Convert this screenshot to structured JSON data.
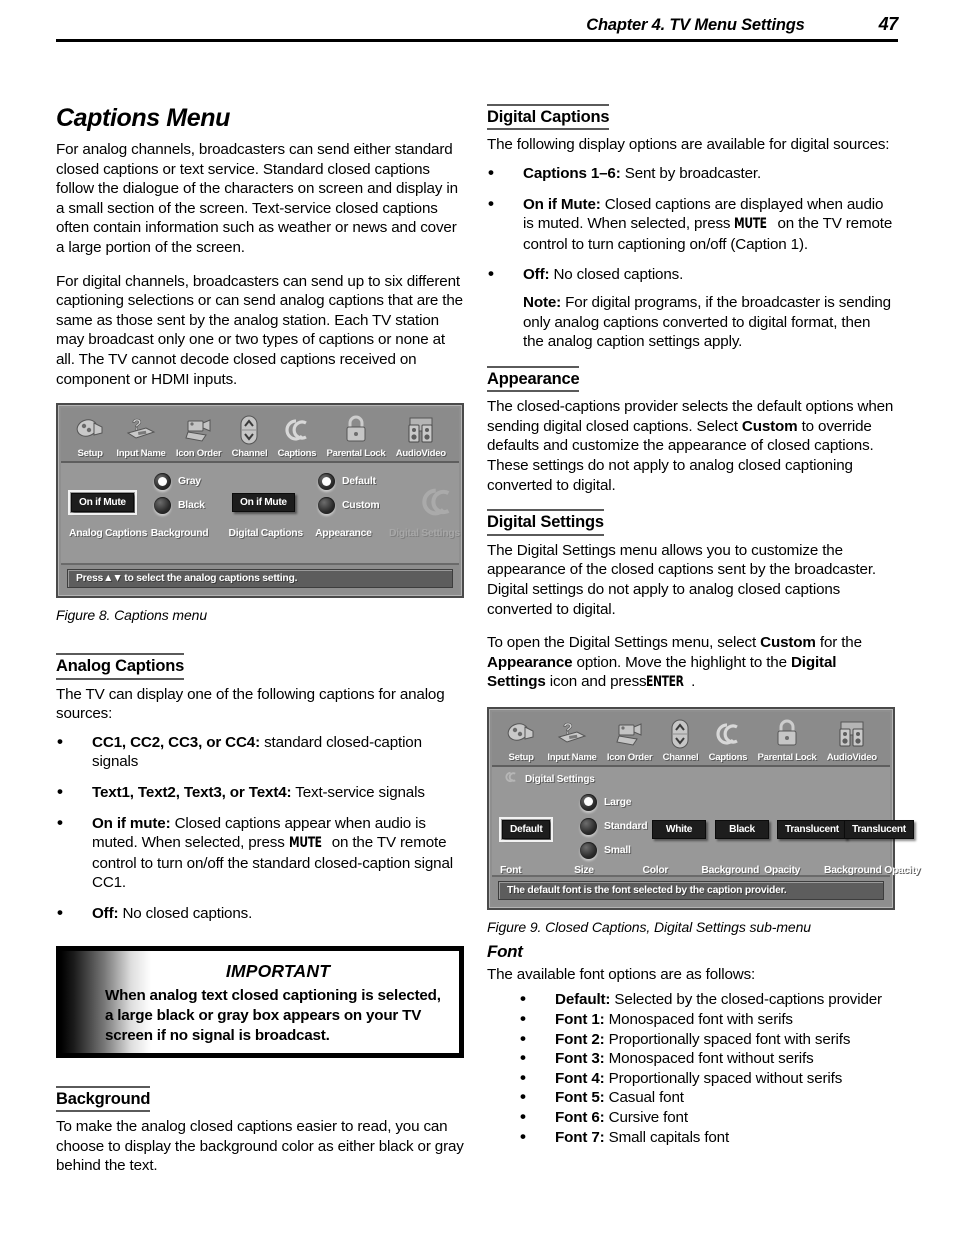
{
  "header": {
    "title": "Chapter 4. TV Menu Settings",
    "page_number": "47"
  },
  "left_column": {
    "doc_title": "Captions Menu",
    "intro_p1": "For analog channels, broadcasters can send either standard closed captions or text service.  Standard closed captions follow the dialogue of the characters on screen and display in a small section of the screen.  Text-service closed captions often contain information such as weather or news and cover a large portion of the screen.",
    "intro_p2": "For digital channels, broadcasters can send up to six different captioning selections or can send analog captions that are the same as those sent by the analog station.  Each TV station may broadcast only one or two types of captions or none at all.  The TV cannot decode closed captions received on component or HDMI inputs.",
    "figure8_caption": "Figure 8. Captions menu",
    "analog_captions_heading": "Analog Captions",
    "analog_captions_intro": "The TV can display one of the following captions for analog sources:",
    "analog_bullets": [
      {
        "term": "CC1, CC2, CC3, or CC4:",
        "desc": "standard closed-caption signals"
      },
      {
        "term": "Text1, Text2, Text3, or Text4:",
        "desc": "Text-service signals"
      },
      {
        "term": "On if mute:",
        "desc_a": "Closed captions appear when audio is muted.  When selected, press",
        "key": "MUTE",
        "desc_b": "on the TV remote control to turn on/off the standard closed-caption signal CC1."
      },
      {
        "term": "Off:",
        "desc": "No closed captions."
      }
    ],
    "important": {
      "title": "IMPORTANT",
      "body": "When analog text closed captioning is selected, a large black or gray box appears on your TV screen if no signal is broadcast."
    },
    "background_heading": "Background",
    "background_text": "To make the analog closed captions easier to read, you can choose to display the background color as either black or gray behind the text."
  },
  "right_column": {
    "digital_captions_heading": "Digital Captions",
    "digital_captions_intro": "The following display options are available for digital sources:",
    "digital_bullets": [
      {
        "term": "Captions 1–6:",
        "desc": "Sent by broadcaster."
      },
      {
        "term": "On if Mute:",
        "desc_a": "Closed captions are displayed when audio is muted.  When selected, press",
        "key": "MUTE",
        "desc_b": "on the TV remote control to turn captioning on/off (Caption 1)."
      },
      {
        "term": "Off:",
        "desc": "No closed captions."
      }
    ],
    "digital_note": {
      "term": "Note:",
      "text": "For digital programs, if the broadcaster is sending only analog captions converted to digital format, then the analog caption settings apply."
    },
    "appearance_heading": "Appearance",
    "appearance_text_a": "The closed-captions provider selects the default options when sending digital closed captions.  Select",
    "appearance_bold": "Custom",
    "appearance_text_b": "to override defaults and customize the appearance of closed captions.  These settings do not apply to analog closed captioning converted to digital.",
    "digital_settings_heading": "Digital Settings",
    "digital_settings_p1": "The Digital Settings menu allows you to customize the appearance of the closed captions sent by the broadcaster.  Digital settings do not apply to analog closed captions converted to digital.",
    "digital_settings_p2_a": "To open the Digital Settings menu, select",
    "digital_settings_p2_bold1": "Custom",
    "digital_settings_p2_b": "for the",
    "digital_settings_p2_bold2": "Appearance",
    "digital_settings_p2_c": "option.  Move the highlight to the",
    "digital_settings_p2_bold3": "Digital Settings",
    "digital_settings_p2_d": "icon and press",
    "digital_settings_p2_key": "ENTER",
    "digital_settings_p2_e": ".",
    "figure9_caption": "Figure 9. Closed Captions, Digital Settings sub-menu",
    "font_heading": "Font",
    "font_intro": "The available font options are as follows:",
    "font_bullets": [
      {
        "term": "Default:",
        "desc": "Selected by the closed-captions provider"
      },
      {
        "term": "Font 1:",
        "desc": "Monospaced font with serifs"
      },
      {
        "term": "Font 2:",
        "desc": "Proportionally spaced font with serifs"
      },
      {
        "term": "Font 3:",
        "desc": "Monospaced font without serifs"
      },
      {
        "term": "Font 4:",
        "desc": "Proportionally spaced without serifs"
      },
      {
        "term": "Font 5:",
        "desc": "Casual font"
      },
      {
        "term": "Font 6:",
        "desc": "Cursive font"
      },
      {
        "term": "Font 7:",
        "desc": "Small capitals font"
      }
    ]
  },
  "figure8": {
    "icon_bar": [
      {
        "label": "Setup",
        "icon": "plug-icon"
      },
      {
        "label": "Input Name",
        "icon": "question-tag-icon"
      },
      {
        "label": "Icon Order",
        "icon": "camera-icon"
      },
      {
        "label": "Channel",
        "icon": "channel-updown-icon"
      },
      {
        "label": "Captions",
        "icon": "captions-icon"
      },
      {
        "label": "Parental Lock",
        "icon": "padlock-icon"
      },
      {
        "label": "AudioVideo",
        "icon": "speakers-icon"
      }
    ],
    "analog_captions_value": "On if Mute",
    "background_options": [
      {
        "label": "Gray",
        "selected": true
      },
      {
        "label": "Black",
        "selected": false
      }
    ],
    "digital_captions_value": "On if Mute",
    "appearance_options": [
      {
        "label": "Default",
        "selected": true
      },
      {
        "label": "Custom",
        "selected": false
      }
    ],
    "column_labels": [
      {
        "label": "Analog Captions",
        "dim": false
      },
      {
        "label": "Background",
        "dim": false
      },
      {
        "label": "Digital Captions",
        "dim": false
      },
      {
        "label": "Appearance",
        "dim": false
      },
      {
        "label": "Digital Settings",
        "dim": true
      }
    ],
    "status_prefix": "Press",
    "status_arrows": "▲▼",
    "status_text": "to select the analog captions setting."
  },
  "figure9": {
    "icon_bar": [
      {
        "label": "Setup",
        "icon": "plug-icon"
      },
      {
        "label": "Input Name",
        "icon": "question-tag-icon"
      },
      {
        "label": "Icon Order",
        "icon": "camera-icon"
      },
      {
        "label": "Channel",
        "icon": "channel-updown-icon"
      },
      {
        "label": "Captions",
        "icon": "captions-icon"
      },
      {
        "label": "Parental Lock",
        "icon": "padlock-icon"
      },
      {
        "label": "AudioVideo",
        "icon": "speakers-icon"
      }
    ],
    "submenu_title": "Digital Settings",
    "font_value": "Default",
    "size_options": [
      {
        "label": "Large",
        "selected": true
      },
      {
        "label": "Standard",
        "selected": false
      },
      {
        "label": "Small",
        "selected": false
      }
    ],
    "color_value": "White",
    "background_value": "Black",
    "opacity_value": "Translucent",
    "background_opacity_value": "Translucent",
    "column_labels": [
      {
        "label": "Font"
      },
      {
        "label": "Size"
      },
      {
        "label": "Color"
      },
      {
        "label": "Background"
      },
      {
        "label": "Opacity"
      },
      {
        "label": "Background Opacity"
      }
    ],
    "status_text": "The default font is the font selected by the caption provider."
  }
}
